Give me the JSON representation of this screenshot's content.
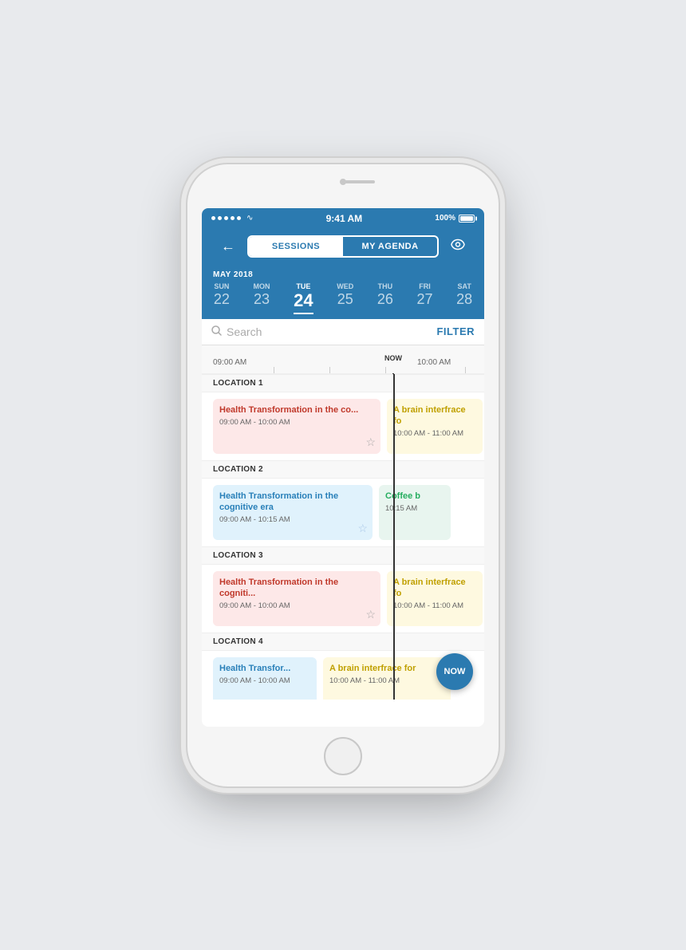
{
  "phone": {
    "status_bar": {
      "time": "9:41 AM",
      "battery": "100%",
      "dots_count": 5
    },
    "header": {
      "back_label": "←",
      "tab_sessions": "SESSIONS",
      "tab_agenda": "MY AGENDA",
      "eye_icon": "👁"
    },
    "date_strip": {
      "month_year": "MAY 2018",
      "days": [
        {
          "name": "SUN",
          "number": "22",
          "active": false
        },
        {
          "name": "MON",
          "number": "23",
          "active": false
        },
        {
          "name": "TUE",
          "number": "24",
          "active": true
        },
        {
          "name": "WED",
          "number": "25",
          "active": false
        },
        {
          "name": "THU",
          "number": "26",
          "active": false
        },
        {
          "name": "FRI",
          "number": "27",
          "active": false
        },
        {
          "name": "SAT",
          "number": "28",
          "active": false
        }
      ]
    },
    "search": {
      "placeholder": "Search",
      "filter_label": "FILTER"
    },
    "timeline": {
      "now_label": "NOW",
      "time_start": "09:00 AM",
      "time_end": "10:00 AM",
      "now_button": "NOW",
      "locations": [
        {
          "name": "LOCATION 1",
          "sessions": [
            {
              "type": "red",
              "title": "Health Transformation in the co...",
              "time": "09:00 AM - 10:00 AM",
              "star": true
            },
            {
              "type": "yellow",
              "title": "A brain interfrace fo",
              "time": "10:00 AM - 11:00 AM",
              "star": false
            }
          ]
        },
        {
          "name": "LOCATION 2",
          "sessions": [
            {
              "type": "blue",
              "title": "Health Transformation in the cognitive era",
              "time": "09:00 AM - 10:15 AM",
              "star": true
            },
            {
              "type": "green",
              "title": "Coffee b",
              "time": "10:15 AM",
              "star": false
            }
          ]
        },
        {
          "name": "LOCATION 3",
          "sessions": [
            {
              "type": "red",
              "title": "Health Transformation in the cogniti...",
              "time": "09:00 AM - 10:00 AM",
              "star": true
            },
            {
              "type": "yellow",
              "title": "A brain interfrace fo",
              "time": "10:00 AM - 11:00 AM",
              "star": false
            }
          ]
        },
        {
          "name": "LOCATION 4",
          "sessions": [
            {
              "type": "blue",
              "title": "Health Transfor...",
              "time": "09:00 AM - 10:00 AM",
              "star": false
            },
            {
              "type": "yellow",
              "title": "A brain interfrace for",
              "time": "10:00 AM - 11:00 AM",
              "star": false
            }
          ]
        }
      ]
    }
  }
}
